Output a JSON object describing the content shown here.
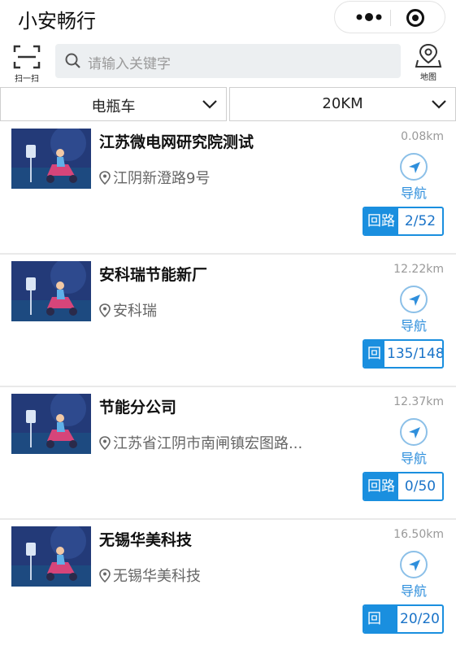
{
  "app": {
    "title": "小安畅行"
  },
  "toolbar": {
    "scan_label": "扫一扫",
    "search_placeholder": "请输入关键字",
    "map_label": "地图"
  },
  "filters": {
    "vehicle_type": "电瓶车",
    "distance": "20KM"
  },
  "colors": {
    "accent": "#1a8fdf",
    "nav_text": "#2f8fdc"
  },
  "stations": [
    {
      "name": "江苏微电网研究院测试",
      "address": "江阴新澄路9号",
      "distance": "0.08km",
      "nav_label": "导航",
      "tag": "回路",
      "count": "2/52"
    },
    {
      "name": "安科瑞节能新厂",
      "address": "安科瑞",
      "distance": "12.22km",
      "nav_label": "导航",
      "tag": "回",
      "count": "135/148"
    },
    {
      "name": "节能分公司",
      "address": "江苏省江阴市南闸镇宏图路...",
      "distance": "12.37km",
      "nav_label": "导航",
      "tag": "回路",
      "count": "0/50"
    },
    {
      "name": "无锡华美科技",
      "address": "无锡华美科技",
      "distance": "16.50km",
      "nav_label": "导航",
      "tag": "回路",
      "count": "20/20"
    }
  ]
}
